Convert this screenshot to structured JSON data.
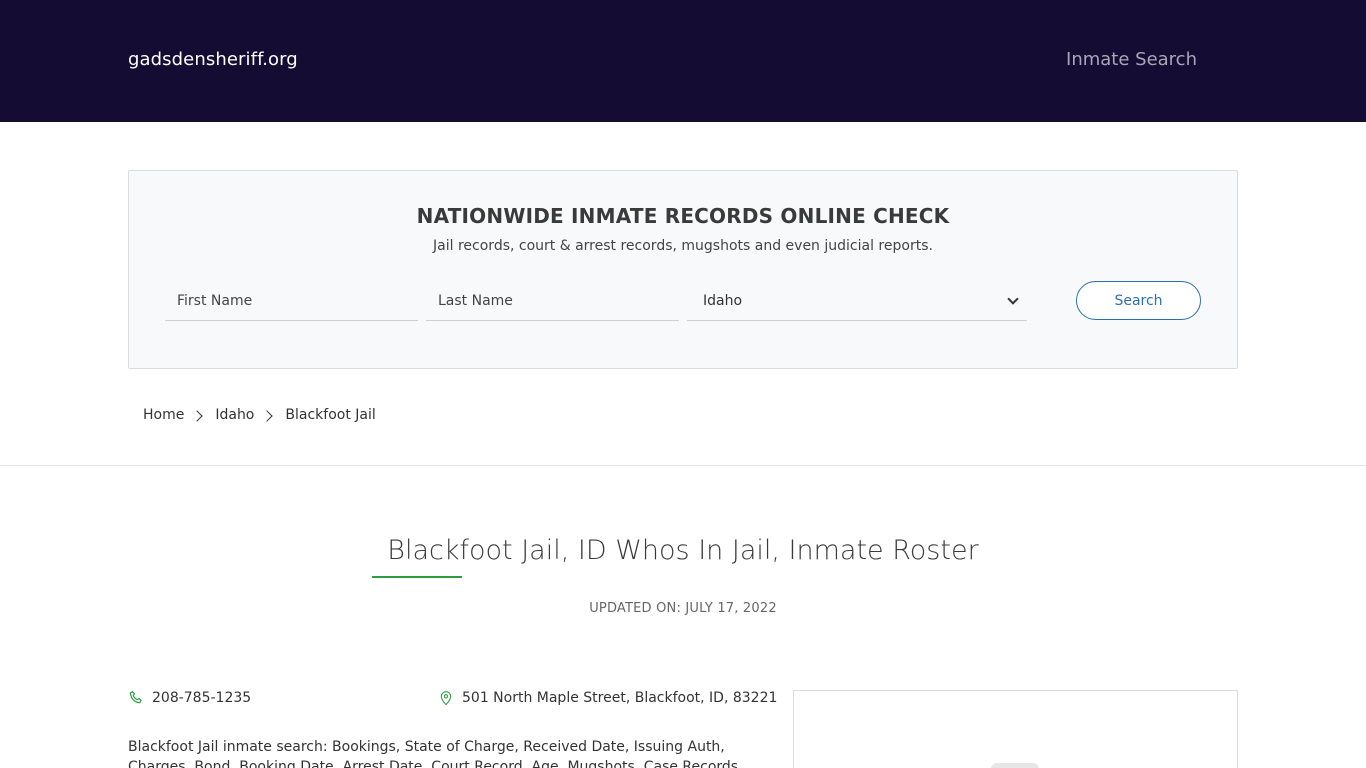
{
  "header": {
    "brand": "gadsdensheriff.org",
    "nav_link": "Inmate Search"
  },
  "search": {
    "title": "NATIONWIDE INMATE RECORDS ONLINE CHECK",
    "subtitle": "Jail records, court & arrest records, mugshots and even judicial reports.",
    "first_name_placeholder": "First Name",
    "last_name_placeholder": "Last Name",
    "state_selected": "Idaho",
    "button_label": "Search"
  },
  "breadcrumb": {
    "items": [
      "Home",
      "Idaho",
      "Blackfoot Jail"
    ]
  },
  "main": {
    "title": "Blackfoot Jail, ID Whos In Jail, Inmate Roster",
    "updated": "UPDATED ON: JULY 17, 2022",
    "phone": "208-785-1235",
    "address": "501 North Maple Street, Blackfoot, ID, 83221",
    "description": "Blackfoot Jail inmate search: Bookings, State of Charge, Received Date, Issuing Auth, Charges, Bond, Booking Date, Arrest Date, Court Record, Age, Mugshots, Case Records"
  },
  "colors": {
    "header_bg": "#150c33",
    "accent_blue": "#2d6fb3",
    "accent_green": "#2e9d3f"
  },
  "icons": {
    "phone": "phone-icon",
    "address": "map-pin-icon",
    "select": "chevron-down-icon",
    "breadcrumb_sep": "chevron-right-icon"
  }
}
